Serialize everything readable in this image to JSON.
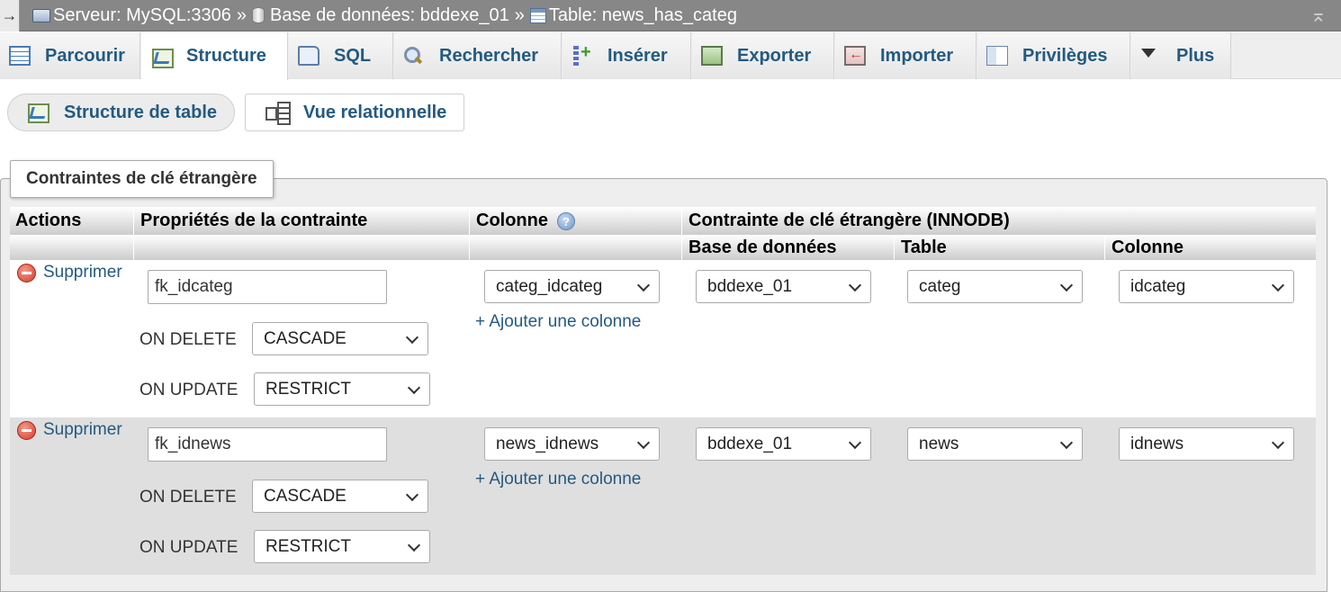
{
  "breadcrumb": {
    "server": "Serveur: MySQL:3306",
    "database": "Base de données: bddexe_01",
    "table": "Table: news_has_categ",
    "separator": "»"
  },
  "tabs": [
    {
      "label": "Parcourir",
      "icon": "browse-icon"
    },
    {
      "label": "Structure",
      "icon": "structure-icon",
      "active": true
    },
    {
      "label": "SQL",
      "icon": "sql-icon"
    },
    {
      "label": "Rechercher",
      "icon": "search-icon"
    },
    {
      "label": "Insérer",
      "icon": "insert-icon"
    },
    {
      "label": "Exporter",
      "icon": "export-icon"
    },
    {
      "label": "Importer",
      "icon": "import-icon"
    },
    {
      "label": "Privilèges",
      "icon": "privileges-icon"
    },
    {
      "label": "Plus",
      "icon": "caret-down-icon"
    }
  ],
  "subtabs": {
    "structure": "Structure de table",
    "relation": "Vue relationnelle"
  },
  "fieldset_legend": "Contraintes de clé étrangère",
  "table": {
    "headers": {
      "actions": "Actions",
      "properties": "Propriétés de la contrainte",
      "column": "Colonne",
      "fk_constraint": "Contrainte de clé étrangère (INNODB)",
      "database": "Base de données",
      "table": "Table",
      "ref_column": "Colonne"
    },
    "rows": [
      {
        "delete_label": "Supprimer",
        "constraint_name": "fk_idcateg",
        "on_delete_label": "ON DELETE",
        "on_delete": "CASCADE",
        "on_update_label": "ON UPDATE",
        "on_update": "RESTRICT",
        "column": "categ_idcateg",
        "add_column": "+ Ajouter une colonne",
        "ref_database": "bddexe_01",
        "ref_table": "categ",
        "ref_column": "idcateg"
      },
      {
        "delete_label": "Supprimer",
        "constraint_name": "fk_idnews",
        "on_delete_label": "ON DELETE",
        "on_delete": "CASCADE",
        "on_update_label": "ON UPDATE",
        "on_update": "RESTRICT",
        "column": "news_idnews",
        "add_column": "+ Ajouter une colonne",
        "ref_database": "bddexe_01",
        "ref_table": "news",
        "ref_column": "idnews"
      }
    ]
  }
}
